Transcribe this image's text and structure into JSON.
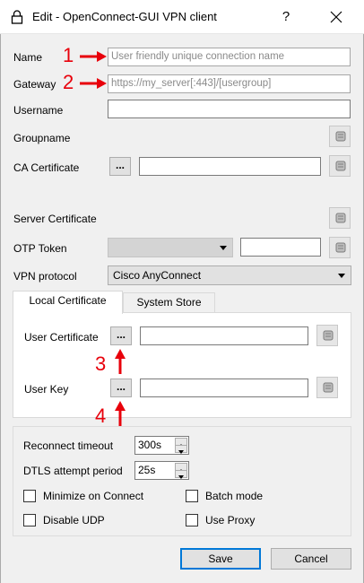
{
  "window": {
    "title": "Edit - OpenConnect-GUI VPN client",
    "help": "?",
    "icons": {
      "title": "lock-icon",
      "close": "close-icon",
      "clear": "eraser-icon"
    }
  },
  "form": {
    "name": {
      "label": "Name",
      "placeholder": "User friendly unique connection name"
    },
    "gateway": {
      "label": "Gateway",
      "placeholder": "https://my_server[:443]/[usergroup]"
    },
    "username": {
      "label": "Username",
      "value": ""
    },
    "groupname": {
      "label": "Groupname"
    },
    "ca_certificate": {
      "label": "CA Certificate",
      "browse": "...",
      "value": ""
    },
    "server_certificate": {
      "label": "Server Certificate"
    },
    "otp_token": {
      "label": "OTP Token",
      "type_value": "",
      "value": ""
    },
    "vpn_protocol": {
      "label": "VPN protocol",
      "value": "Cisco AnyConnect"
    }
  },
  "tabs": [
    {
      "label": "Local Certificate",
      "active": true
    },
    {
      "label": "System Store",
      "active": false
    }
  ],
  "local_certificate": {
    "user_certificate": {
      "label": "User Certificate",
      "browse": "...",
      "value": ""
    },
    "user_key": {
      "label": "User Key",
      "browse": "...",
      "value": ""
    }
  },
  "options": {
    "reconnect_timeout": {
      "label": "Reconnect timeout",
      "value": "300s"
    },
    "dtls_attempt_period": {
      "label": "DTLS attempt period",
      "value": "25s"
    },
    "minimize_on_connect": {
      "label": "Minimize on Connect",
      "checked": false
    },
    "batch_mode": {
      "label": "Batch mode",
      "checked": false
    },
    "disable_udp": {
      "label": "Disable UDP",
      "checked": false
    },
    "use_proxy": {
      "label": "Use Proxy",
      "checked": false
    }
  },
  "buttons": {
    "save": "Save",
    "cancel": "Cancel"
  },
  "annotations": {
    "one": "1",
    "two": "2",
    "three": "3",
    "four": "4",
    "color": "#e8000b"
  }
}
